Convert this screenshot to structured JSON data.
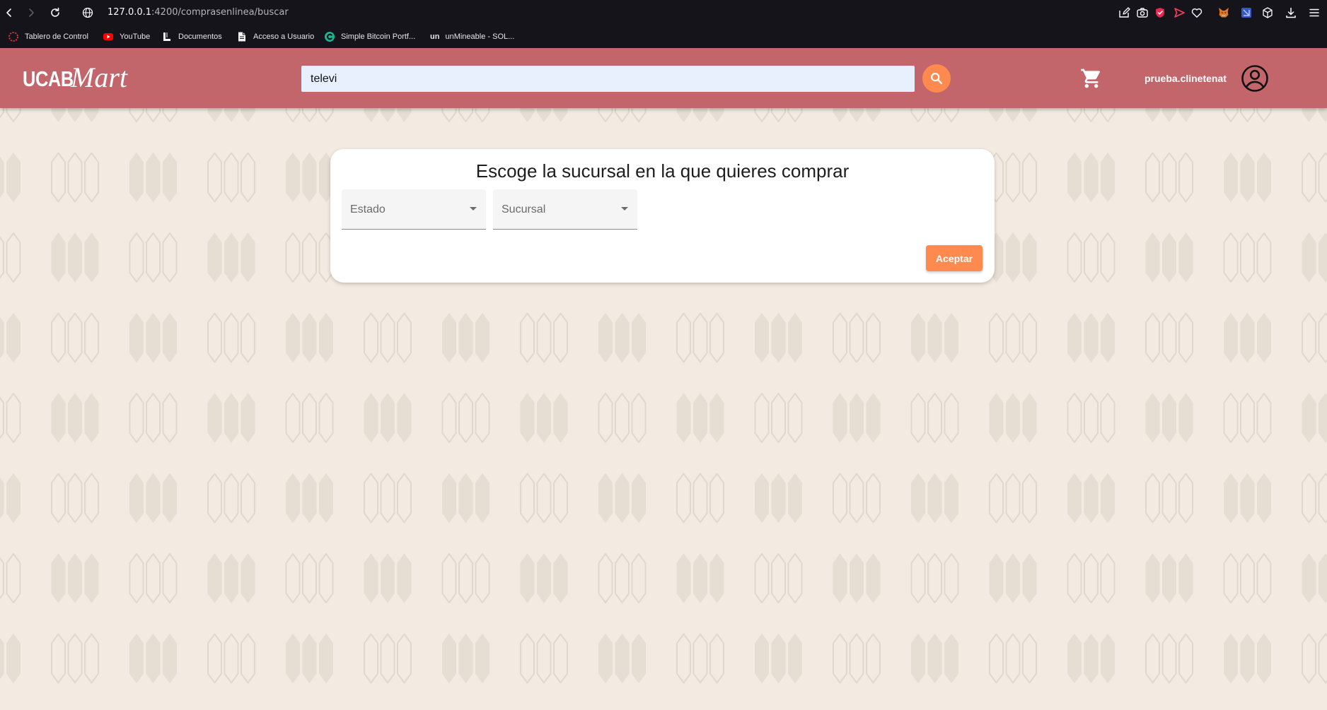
{
  "browser": {
    "url_host": "127.0.0.1",
    "url_path": ":4200/comprasenlinea/buscar",
    "nav_icons": [
      "back-icon",
      "forward-icon",
      "reload-icon",
      "site-info-icon"
    ],
    "toolbar_icons": [
      "edit-share-icon",
      "screenshot-icon",
      "shield-extension-icon",
      "send-extension-icon",
      "favorite-icon",
      "metamask-icon",
      "extension-icon",
      "cube-extension-icon",
      "download-icon",
      "menu-icon"
    ],
    "bookmarks": [
      {
        "label": "Tablero de Control",
        "icon": "dashboard-favicon"
      },
      {
        "label": "YouTube",
        "icon": "youtube-favicon"
      },
      {
        "label": "Documentos",
        "icon": "docs-favicon"
      },
      {
        "label": "Acceso a Usuario",
        "icon": "page-favicon"
      },
      {
        "label": "Simple Bitcoin Portf...",
        "icon": "bitcoin-portfolio-favicon"
      },
      {
        "label": "unMineable - SOL...",
        "icon": "unmineable-favicon",
        "icon_text": "un"
      }
    ]
  },
  "header": {
    "logo_primary": "UCAB",
    "logo_script": "Mart",
    "search_value": "televi",
    "search_button_icon": "search-icon",
    "cart_icon": "shopping-cart-icon",
    "user_name": "prueba.clinetenat",
    "account_icon": "account-circle-icon"
  },
  "branch_card": {
    "title": "Escoge la sucursal en la que quieres comprar",
    "estado_label": "Estado",
    "sucursal_label": "Sucursal",
    "accept_label": "Aceptar"
  },
  "colors": {
    "browser_chrome": "#15141a",
    "header_background": "#c3666c",
    "accent_orange": "#ff8a50",
    "page_background": "#f3ebe2",
    "search_field_background": "#e8f0fe"
  }
}
